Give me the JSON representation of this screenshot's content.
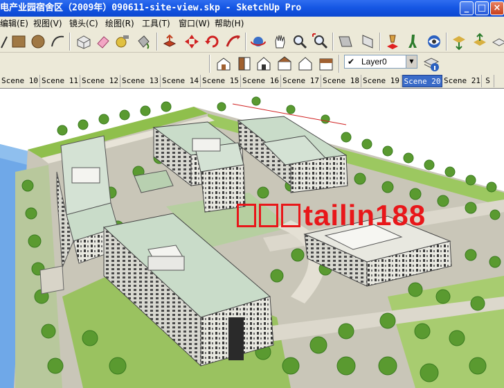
{
  "window": {
    "title": "电产业园宿舍区（2009年）090611-site-view.skp - SketchUp Pro",
    "buttons": {
      "minimize": "_",
      "maximize": "□",
      "close": "×"
    }
  },
  "menu": [
    {
      "label": "编辑(E)"
    },
    {
      "label": "视图(V)"
    },
    {
      "label": "镜头(C)"
    },
    {
      "label": "绘图(R)"
    },
    {
      "label": "工具(T)"
    },
    {
      "label": "窗口(W)"
    },
    {
      "label": "帮助(H)"
    }
  ],
  "toolbar": {
    "layer_value": "Layer0",
    "layer_check": "✔",
    "dropdown_glyph": "▼"
  },
  "scenes": [
    {
      "label": "Scene 10"
    },
    {
      "label": "Scene 11"
    },
    {
      "label": "Scene 12"
    },
    {
      "label": "Scene 13"
    },
    {
      "label": "Scene 14"
    },
    {
      "label": "Scene 15"
    },
    {
      "label": "Scene 16"
    },
    {
      "label": "Scene 17"
    },
    {
      "label": "Scene 18"
    },
    {
      "label": "Scene 19"
    },
    {
      "label": "Scene 20"
    },
    {
      "label": "Scene 21"
    },
    {
      "label": "S"
    }
  ],
  "active_scene": "Scene 20",
  "watermark": "tailin188",
  "colors": {
    "titlebar": "#1657e4",
    "ground": "#c8c5b8",
    "grass": "#8fbf4c",
    "water": "#6fa8e8",
    "roof": "#c9dcc9",
    "watermark": "#e8171a"
  }
}
